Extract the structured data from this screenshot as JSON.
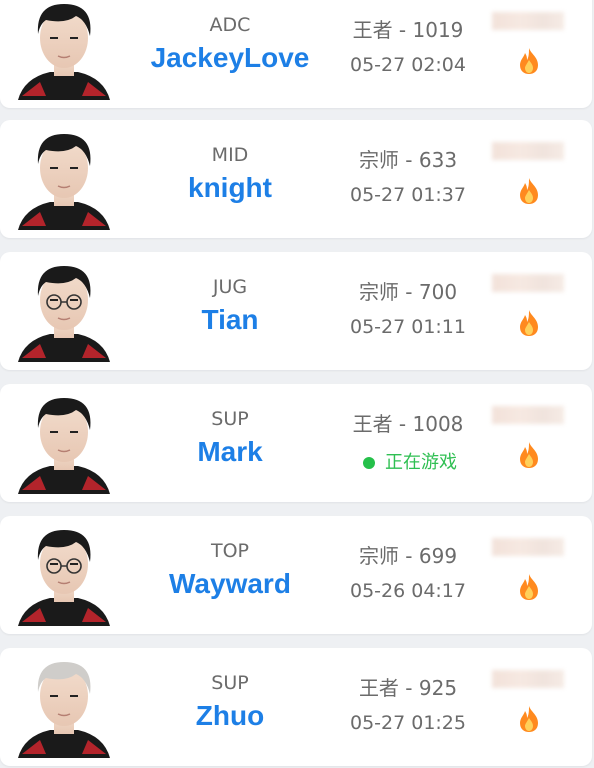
{
  "players": [
    {
      "role": "ADC",
      "name": "JackeyLove",
      "rank": "王者 - 1019",
      "time": "05-27 02:04",
      "status": "time"
    },
    {
      "role": "MID",
      "name": "knight",
      "rank": "宗师 - 633",
      "time": "05-27 01:37",
      "status": "time"
    },
    {
      "role": "JUG",
      "name": "Tian",
      "rank": "宗师 - 700",
      "time": "05-27 01:11",
      "status": "time"
    },
    {
      "role": "SUP",
      "name": "Mark",
      "rank": "王者 - 1008",
      "time": "正在游戏",
      "status": "live"
    },
    {
      "role": "TOP",
      "name": "Wayward",
      "rank": "宗师 - 699",
      "time": "05-26 04:17",
      "status": "time"
    },
    {
      "role": "SUP",
      "name": "Zhuo",
      "rank": "王者 - 925",
      "time": "05-27 01:25",
      "status": "time"
    }
  ],
  "icons": {
    "fire": "fire-icon",
    "live_dot": "online-status-dot"
  },
  "colors": {
    "name": "#1d7fe6",
    "live": "#2fbf52",
    "fire": "#ff8a1f"
  }
}
